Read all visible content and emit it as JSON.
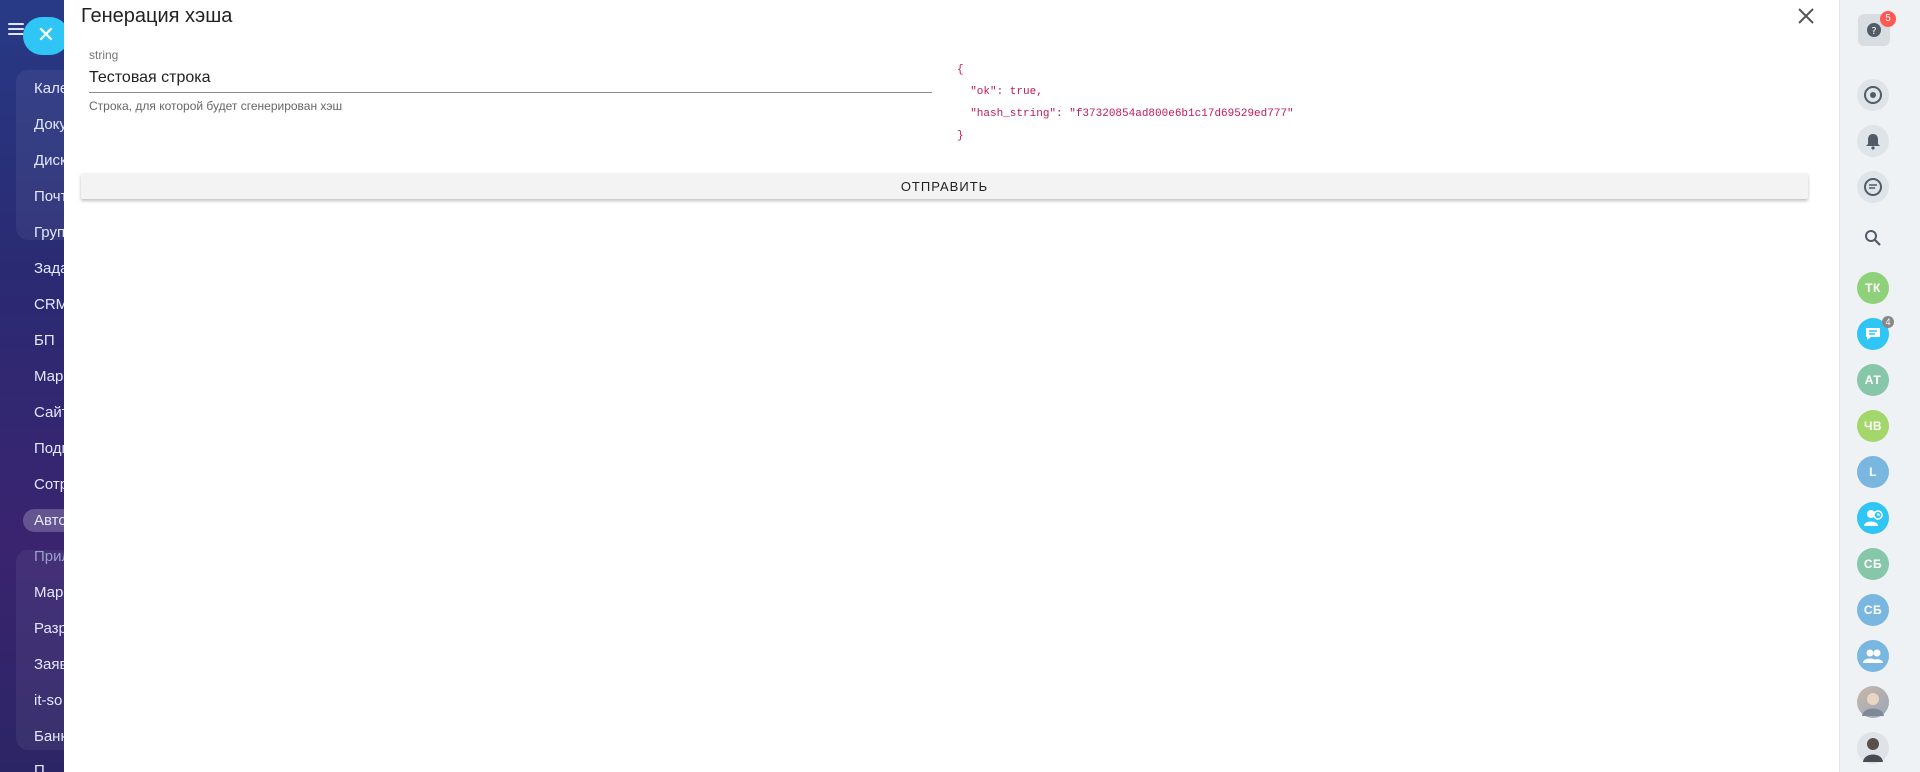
{
  "modal": {
    "title": "Генерация хэша",
    "field": {
      "label": "string",
      "value": "Тестовая строка",
      "hint": "Строка, для которой будет сгенерирован хэш"
    },
    "response": {
      "open": "{",
      "line1": "  \"ok\": true,",
      "line2": "  \"hash_string\": \"f37320854ad800e6b1c17d69529ed777\"",
      "close": "}"
    },
    "submit_label": "ОТПРАВИТЬ"
  },
  "left_menu": {
    "items": [
      "Кале",
      "Доку",
      "Диск",
      "Почт",
      "Груп",
      "Зада",
      "CRM",
      "БП",
      "Мар",
      "Сайт",
      "Подп",
      "Сотр",
      "Авто",
      "Прил",
      "Марк",
      "Разр",
      "Заяв",
      "it-so",
      "Банк",
      "П"
    ]
  },
  "right_bar": {
    "help_badge": "5",
    "chat_badge": "4",
    "avatars": [
      "ТК",
      "АТ",
      "ЧВ",
      "L",
      "СБ",
      "СБ"
    ],
    "colors": {
      "tk": "#8fd17a",
      "at": "#86c6a9",
      "chv": "#a3d76b",
      "l": "#7ab7e0",
      "sb1": "#86c6a9",
      "sb2": "#7ab7e0",
      "accent": "#2fc6f6"
    }
  }
}
